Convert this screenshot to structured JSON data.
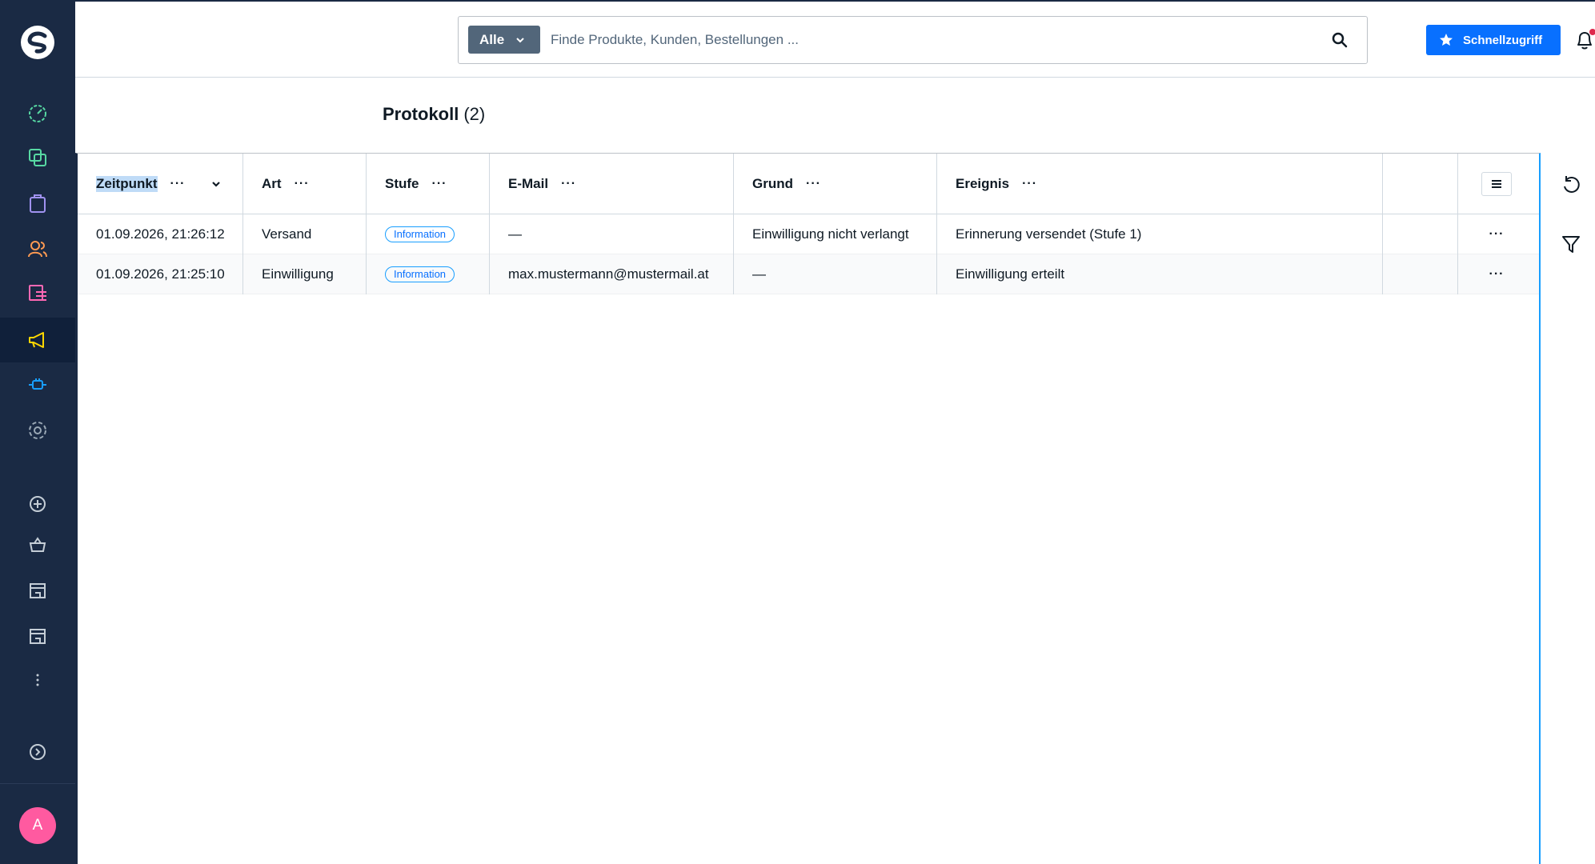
{
  "topbar": {
    "filter_label": "Alle",
    "search_placeholder": "Finde Produkte, Kunden, Bestellungen ...",
    "quick_access_label": "Schnellzugriff"
  },
  "sidebar": {
    "avatar_initial": "A",
    "items": [
      {
        "icon": "dashboard-icon",
        "color": "#57d9a3"
      },
      {
        "icon": "catalog-icon",
        "color": "#57d9a3"
      },
      {
        "icon": "orders-icon",
        "color": "#a092f0"
      },
      {
        "icon": "customers-icon",
        "color": "#ff9a52"
      },
      {
        "icon": "content-icon",
        "color": "#ff68b4"
      },
      {
        "icon": "marketing-icon",
        "color": "#ffd700"
      },
      {
        "icon": "extensions-icon",
        "color": "#189eff"
      },
      {
        "icon": "settings-icon",
        "color": "#9aa8b5"
      }
    ]
  },
  "page": {
    "title": "Protokoll",
    "count": "(2)"
  },
  "grid": {
    "columns": [
      "Zeitpunkt",
      "Art",
      "Stufe",
      "E-Mail",
      "Grund",
      "Ereignis"
    ],
    "rows": [
      {
        "zeitpunkt": "01.09.2026, 21:26:12",
        "art": "Versand",
        "stufe": "Information",
        "email": "—",
        "grund": "Einwilligung nicht verlangt",
        "ereignis": "Erinnerung versendet (Stufe 1)"
      },
      {
        "zeitpunkt": "01.09.2026, 21:25:10",
        "art": "Einwilligung",
        "stufe": "Information",
        "email": "max.mustermann@mustermail.at",
        "grund": "—",
        "ereignis": "Einwilligung erteilt"
      }
    ]
  }
}
